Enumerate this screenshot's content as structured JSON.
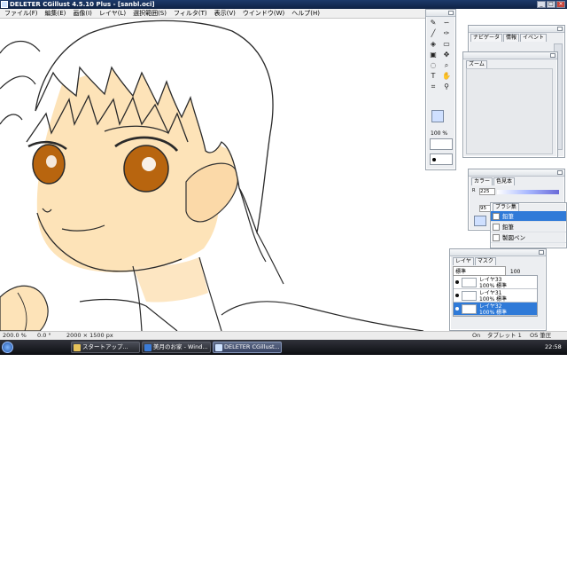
{
  "window": {
    "title": "DELETER CGillust 4.5.10 Plus - [sanbl.oci]",
    "controls": {
      "minimize": "_",
      "maximize": "□",
      "close": "×"
    }
  },
  "menubar": {
    "items": [
      "ファイル(F)",
      "編集(E)",
      "画像(I)",
      "レイヤ(L)",
      "選択範囲(S)",
      "フィルタ(T)",
      "表示(V)",
      "ウインドウ(W)",
      "ヘルプ(H)"
    ]
  },
  "toolbox": {
    "zoom_value": "100",
    "zoom_unit": "%",
    "icons": [
      "pen-icon",
      "lasso-icon",
      "brush-icon",
      "airbrush-icon",
      "bucket-icon",
      "eraser-icon",
      "rect-select-icon",
      "move-icon",
      "lasso-select-icon",
      "magnifier-icon",
      "text-icon",
      "hand-icon",
      "crop-icon",
      "eyedropper-icon",
      "line-icon",
      "zoom-icon"
    ]
  },
  "navigator_panel": {
    "tabs": [
      "ナビゲータ",
      "情報",
      "イベント"
    ]
  },
  "zoom_panel": {
    "title": "ズーム"
  },
  "color_panel": {
    "tabs": [
      "カラー",
      "色見本"
    ],
    "value_r": "225",
    "value_b": "95"
  },
  "brush_panel": {
    "title": "ブラシ集",
    "items": [
      {
        "label": "鉛筆",
        "selected": true
      },
      {
        "label": "鉛筆",
        "selected": false
      },
      {
        "label": "製図ペン",
        "selected": false
      }
    ]
  },
  "layer_panel": {
    "tabs": [
      "レイヤ",
      "マスク"
    ],
    "blend_mode": "標準",
    "opacity": "100",
    "layers": [
      {
        "name": "レイヤ33",
        "info": "100% 標準",
        "selected": false
      },
      {
        "name": "レイヤ31",
        "info": "100% 標準",
        "selected": false
      },
      {
        "name": "レイヤ32",
        "info": "100% 標準",
        "selected": true
      }
    ]
  },
  "statusbar": {
    "zoom": "200.0 %",
    "angle": "0.0 °",
    "size": "2000 × 1500 px",
    "pen_status": "On",
    "tablet": "タブレット 1",
    "os_pressure": "OS 筆圧"
  },
  "taskbar": {
    "buttons": [
      {
        "label": "スタートアップ...",
        "active": false
      },
      {
        "label": "美月のお家 - Wind...",
        "active": false
      },
      {
        "label": "DELETER CGillust...",
        "active": true
      }
    ],
    "clock": "22:58"
  },
  "colors": {
    "titlebar": "#0f2244",
    "selection": "#2f7ad8",
    "skin": "#fde3b8",
    "eyes": "#b8650f"
  }
}
